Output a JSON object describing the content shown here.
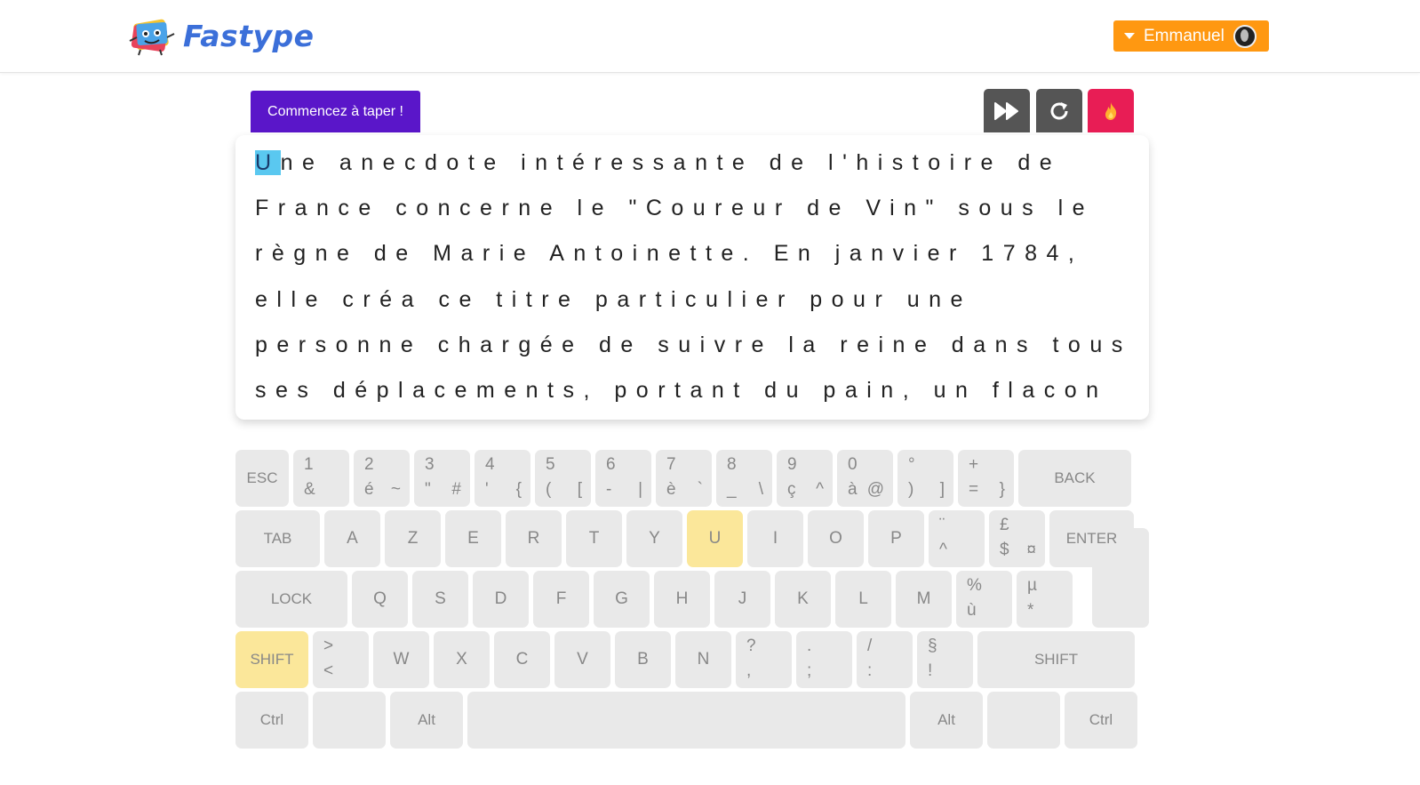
{
  "header": {
    "logo_text": "Fastype",
    "user_name": "Emmanuel"
  },
  "toolbar": {
    "start_label": "Commencez à taper !",
    "buttons": [
      "fast-forward-icon",
      "reload-icon",
      "fire-icon"
    ]
  },
  "colors": {
    "brand": "#3b6fd9",
    "user_button": "#ff9811",
    "start_tab": "#5a16c9",
    "fire_button": "#e81d55",
    "highlight_key": "#fbe79a",
    "cursor": "#5ac8f0"
  },
  "text": {
    "cursor_char": "U",
    "lines": [
      "ne anecdote intéressante de l'histoire de",
      "France concerne le \"Coureur de Vin\" sous le",
      "règne de Marie Antoinette. En janvier 1784,",
      "elle créa ce titre particulier pour une",
      "personne chargée de suivre la reine dans tous",
      "ses déplacements, portant du pain, un flacon"
    ]
  },
  "keyboard": {
    "row1": [
      {
        "label": "ESC"
      },
      {
        "tl": "1",
        "bl": "&"
      },
      {
        "tl": "2",
        "bl": "é",
        "br": "~"
      },
      {
        "tl": "3",
        "bl": "\"",
        "br": "#"
      },
      {
        "tl": "4",
        "bl": "'",
        "br": "{"
      },
      {
        "tl": "5",
        "bl": "(",
        "br": "["
      },
      {
        "tl": "6",
        "bl": "-",
        "br": "|"
      },
      {
        "tl": "7",
        "bl": "è",
        "br": "`"
      },
      {
        "tl": "8",
        "bl": "_",
        "br": "\\"
      },
      {
        "tl": "9",
        "bl": "ç",
        "br": "^"
      },
      {
        "tl": "0",
        "bl": "à",
        "br": "@"
      },
      {
        "tl": "°",
        "bl": ")",
        "br": "]"
      },
      {
        "tl": "+",
        "bl": "=",
        "br": "}"
      },
      {
        "label": "BACK"
      }
    ],
    "row2": [
      {
        "label": "TAB"
      },
      {
        "label": "A"
      },
      {
        "label": "Z"
      },
      {
        "label": "E"
      },
      {
        "label": "R"
      },
      {
        "label": "T"
      },
      {
        "label": "Y"
      },
      {
        "label": "U"
      },
      {
        "label": "I"
      },
      {
        "label": "O"
      },
      {
        "label": "P"
      },
      {
        "tl": "¨",
        "bl": "^"
      },
      {
        "tl": "£",
        "bl": "$",
        "br": "¤"
      },
      {
        "label": "ENTER"
      }
    ],
    "row3": [
      {
        "label": "LOCK"
      },
      {
        "label": "Q"
      },
      {
        "label": "S"
      },
      {
        "label": "D"
      },
      {
        "label": "F"
      },
      {
        "label": "G"
      },
      {
        "label": "H"
      },
      {
        "label": "J"
      },
      {
        "label": "K"
      },
      {
        "label": "L"
      },
      {
        "label": "M"
      },
      {
        "tl": "%",
        "bl": "ù"
      },
      {
        "tl": "µ",
        "bl": "*"
      }
    ],
    "row4": [
      {
        "label": "SHIFT"
      },
      {
        "tl": ">",
        "bl": "<"
      },
      {
        "label": "W"
      },
      {
        "label": "X"
      },
      {
        "label": "C"
      },
      {
        "label": "V"
      },
      {
        "label": "B"
      },
      {
        "label": "N"
      },
      {
        "tl": "?",
        "bl": ","
      },
      {
        "tl": ".",
        "bl": ";"
      },
      {
        "tl": "/",
        "bl": ":"
      },
      {
        "tl": "§",
        "bl": "!"
      },
      {
        "label": "SHIFT"
      }
    ],
    "row5": [
      {
        "label": "Ctrl"
      },
      {
        "label": ""
      },
      {
        "label": "Alt"
      },
      {
        "label": ""
      },
      {
        "label": "Alt"
      },
      {
        "label": ""
      },
      {
        "label": "Ctrl"
      }
    ],
    "highlighted": [
      "U",
      "SHIFT-left"
    ]
  }
}
